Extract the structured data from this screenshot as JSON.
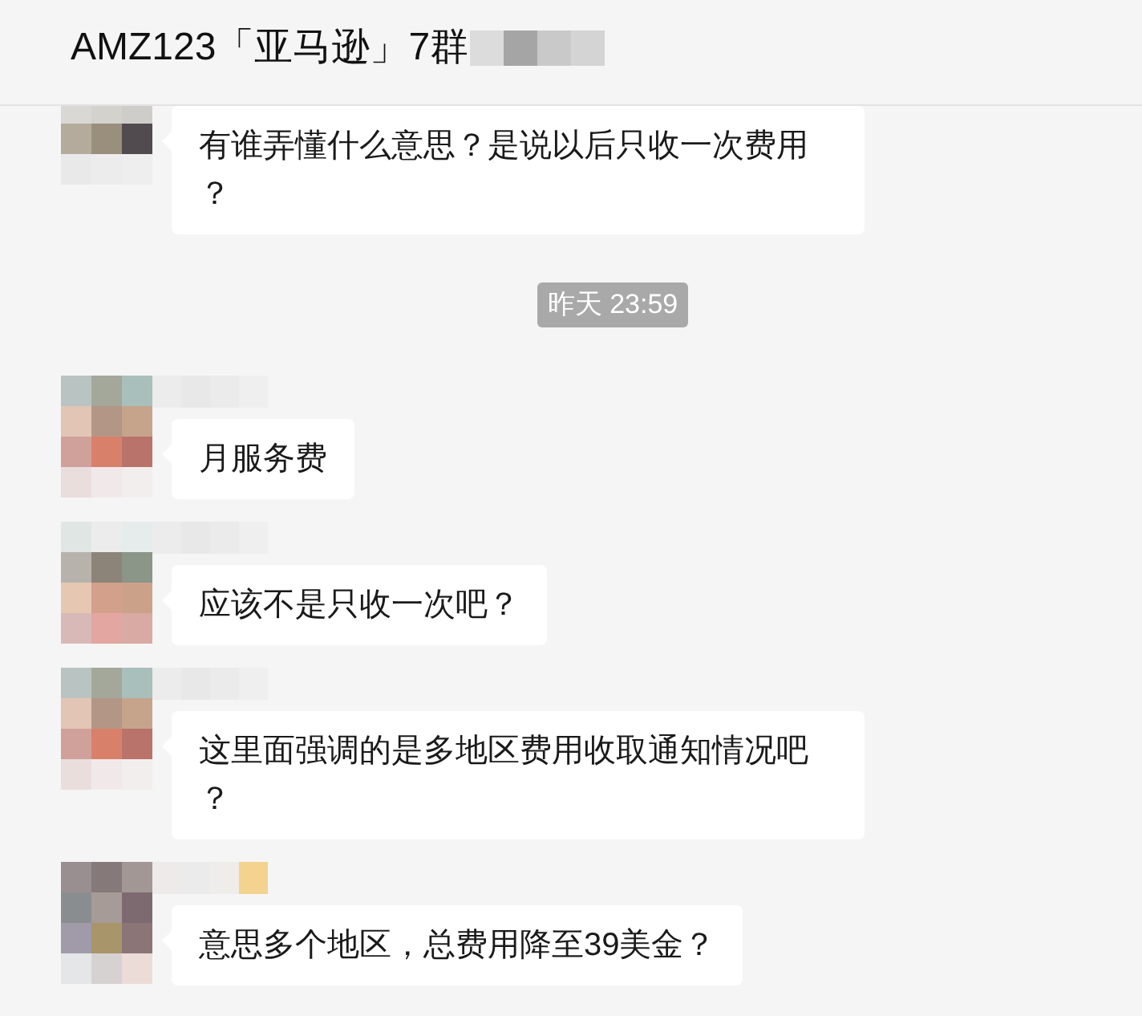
{
  "header": {
    "title": "AMZ123「亚马逊」7群"
  },
  "messages": [
    {
      "kind": "text",
      "text": "有谁弄懂什么意思？是说以后只收一次费用？"
    },
    {
      "kind": "time",
      "text": "昨天 23:59"
    },
    {
      "kind": "text",
      "text": "月服务费"
    },
    {
      "kind": "text",
      "text": "应该不是只收一次吧？"
    },
    {
      "kind": "text",
      "text": "这里面强调的是多地区费用收取通知情况吧？"
    },
    {
      "kind": "text",
      "text": "意思多个地区，总费用降至39美金？"
    }
  ]
}
